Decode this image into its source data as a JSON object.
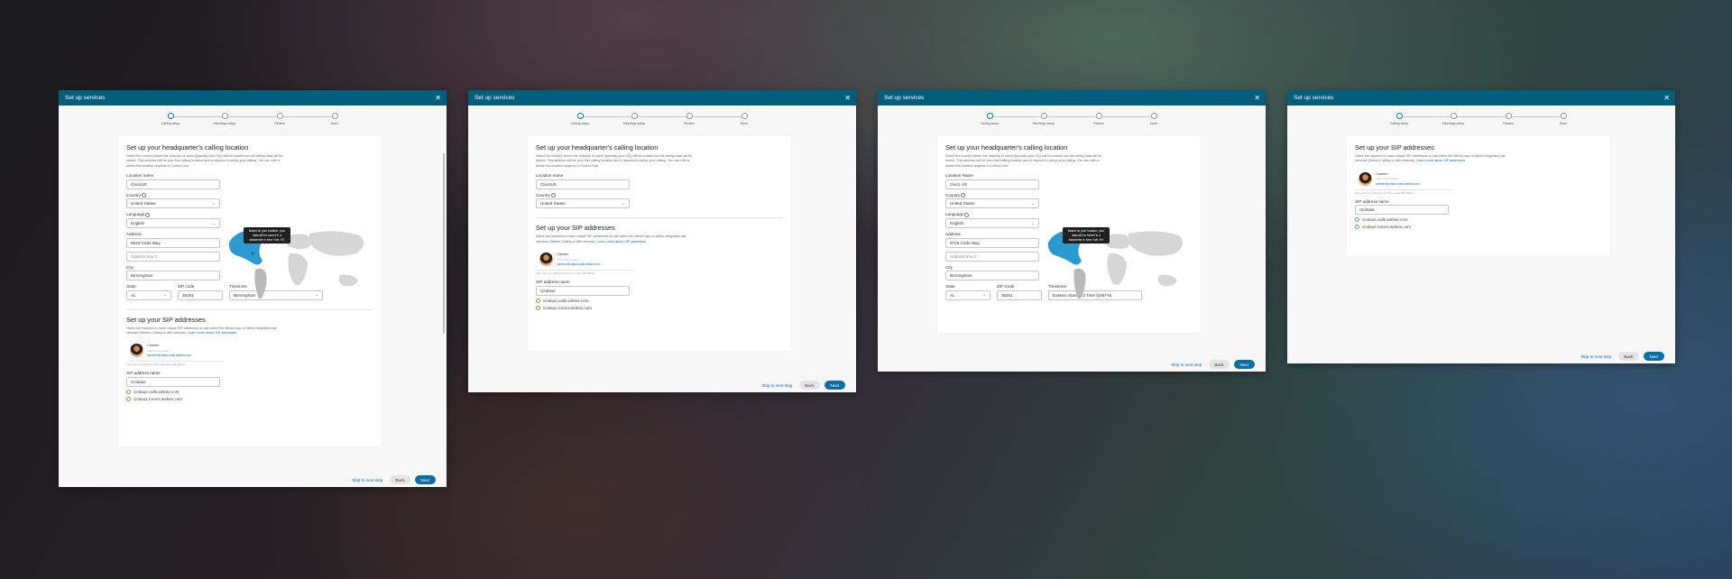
{
  "dialog_title": "Set up services",
  "close_glyph": "✕",
  "steps": [
    "Calling setup",
    "Meetings setup",
    "Review",
    "Done"
  ],
  "location": {
    "heading": "Set up your headquarter's calling location",
    "description": "Select the country where the majority of users (typically your HQ) will be located and all calling data will be stored. This address will be your first calling location and is required to setup your calling. You can edit or delete this location anytime in Control Hub.",
    "location_name_label": "Location name",
    "location_name_label_alt": "Location Name",
    "location_name_value": "CiscoUS",
    "location_name_value_alt": "Cisco US",
    "country_label": "Country",
    "country_value": "United States",
    "language_label": "Language",
    "language_value": "English",
    "address_label": "Address",
    "address1_value": "9615 Cirdo Way",
    "address1_value_alt": "9715 Cirdo Way",
    "address2_placeholder": "Address line 2",
    "city_label": "City",
    "city_value": "Birmingham",
    "state_label": "State",
    "state_value": "AL",
    "zip_label": "ZIP code",
    "zip_label_alt": "ZIP Code",
    "zip_value": "35201",
    "timezone_label": "Timezone",
    "timezone_value": "Birmingham",
    "timezone_value_alt": "Eastern Standard Time (GMT-5)",
    "map_tooltip": "Based on your location, your data will be stored in a datacenter in New York, NY"
  },
  "sip": {
    "heading": "Set up your SIP addresses",
    "description": "Users are required to have unique SIP addresses to call within the Webex app or within integrated call services (Webex Calling or with devices).",
    "link": "Learn more about SIP addresses",
    "profile_name": "Carmen",
    "profile_meta": "Admin at company",
    "profile_email": "carmen@cinitus.calls.webex.com",
    "small_note": "Users set up on Settings to see their unique SIP address",
    "address_name_label": "SIP address name",
    "address_name_value": "Cinitaus",
    "address_name_value_alt": "Cinitaus",
    "domain1": "cinitaus.calls.webex.com",
    "domain2": "cinitaus.rooms.webex.com"
  },
  "footer": {
    "skip": "Skip to next step",
    "back": "Back",
    "next": "Next"
  }
}
